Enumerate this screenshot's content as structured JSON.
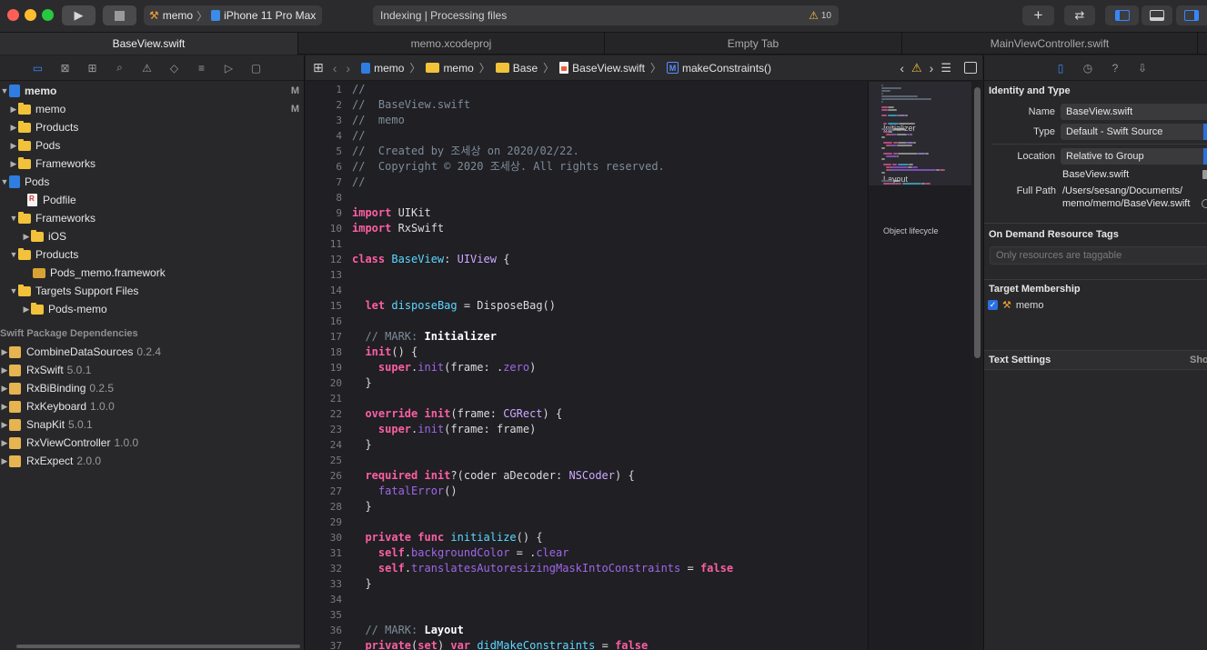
{
  "toolbar": {
    "scheme_project": "memo",
    "scheme_device": "iPhone 11 Pro Max",
    "activity_text": "Indexing | Processing files",
    "warning_count": "10"
  },
  "tabs": [
    "BaseView.swift",
    "memo.xcodeproj",
    "Empty Tab",
    "MainViewController.swift"
  ],
  "navigator": {
    "tree": [
      {
        "label": "memo",
        "flag": "M"
      },
      {
        "label": "memo",
        "flag": "M"
      },
      {
        "label": "Products"
      },
      {
        "label": "Pods"
      },
      {
        "label": "Frameworks"
      },
      {
        "label": "Pods"
      },
      {
        "label": "Podfile"
      },
      {
        "label": "Frameworks"
      },
      {
        "label": "iOS"
      },
      {
        "label": "Products"
      },
      {
        "label": "Pods_memo.framework"
      },
      {
        "label": "Targets Support Files"
      },
      {
        "label": "Pods-memo"
      }
    ],
    "packages_header": "Swift Package Dependencies",
    "packages": [
      {
        "name": "CombineDataSources",
        "version": "0.2.4"
      },
      {
        "name": "RxSwift",
        "version": "5.0.1"
      },
      {
        "name": "RxBiBinding",
        "version": "0.2.5"
      },
      {
        "name": "RxKeyboard",
        "version": "1.0.0"
      },
      {
        "name": "SnapKit",
        "version": "5.0.1"
      },
      {
        "name": "RxViewController",
        "version": "1.0.0"
      },
      {
        "name": "RxExpect",
        "version": "2.0.0"
      }
    ]
  },
  "jumpbar": {
    "path": [
      "memo",
      "memo",
      "Base",
      "BaseView.swift"
    ],
    "symbol": "makeConstraints()"
  },
  "editor": {
    "line_numbers": [
      "1",
      "2",
      "3",
      "4",
      "5",
      "6",
      "7",
      "8",
      "9",
      "10",
      "11",
      "12",
      "13",
      "14",
      "15",
      "16",
      "17",
      "18",
      "19",
      "20",
      "21",
      "22",
      "23",
      "24",
      "25",
      "26",
      "27",
      "28",
      "29",
      "30",
      "31",
      "32",
      "33",
      "34",
      "35",
      "36",
      "37"
    ],
    "lines": [
      [
        {
          "c": "cmt",
          "t": "//"
        }
      ],
      [
        {
          "c": "cmt",
          "t": "//  BaseView.swift"
        }
      ],
      [
        {
          "c": "cmt",
          "t": "//  memo"
        }
      ],
      [
        {
          "c": "cmt",
          "t": "//"
        }
      ],
      [
        {
          "c": "cmt",
          "t": "//  Created by 조세상 on 2020/02/22."
        }
      ],
      [
        {
          "c": "cmt",
          "t": "//  Copyright © 2020 조세상. All rights reserved."
        }
      ],
      [
        {
          "c": "cmt",
          "t": "//"
        }
      ],
      [],
      [
        {
          "c": "kw",
          "t": "import"
        },
        {
          "c": "",
          "t": " UIKit"
        }
      ],
      [
        {
          "c": "kw",
          "t": "import"
        },
        {
          "c": "",
          "t": " RxSwift"
        }
      ],
      [],
      [
        {
          "c": "kw",
          "t": "class"
        },
        {
          "c": "",
          "t": " "
        },
        {
          "c": "ty",
          "t": "BaseView"
        },
        {
          "c": "",
          "t": ": "
        },
        {
          "c": "ty2",
          "t": "UIView"
        },
        {
          "c": "",
          "t": " {"
        }
      ],
      [],
      [],
      [
        {
          "c": "",
          "t": "  "
        },
        {
          "c": "kw",
          "t": "let"
        },
        {
          "c": "",
          "t": " "
        },
        {
          "c": "ty",
          "t": "disposeBag"
        },
        {
          "c": "",
          "t": " = DisposeBag()"
        }
      ],
      [],
      [
        {
          "c": "cmt",
          "t": "  // MARK: "
        },
        {
          "c": "mark",
          "t": "Initializer"
        }
      ],
      [
        {
          "c": "",
          "t": "  "
        },
        {
          "c": "kw",
          "t": "init"
        },
        {
          "c": "",
          "t": "() {"
        }
      ],
      [
        {
          "c": "",
          "t": "    "
        },
        {
          "c": "kw",
          "t": "super"
        },
        {
          "c": "",
          "t": "."
        },
        {
          "c": "prop",
          "t": "init"
        },
        {
          "c": "",
          "t": "(frame: ."
        },
        {
          "c": "prop",
          "t": "zero"
        },
        {
          "c": "",
          "t": ")"
        }
      ],
      [
        {
          "c": "",
          "t": "  }"
        }
      ],
      [],
      [
        {
          "c": "",
          "t": "  "
        },
        {
          "c": "kw",
          "t": "override"
        },
        {
          "c": "",
          "t": " "
        },
        {
          "c": "kw",
          "t": "init"
        },
        {
          "c": "",
          "t": "(frame: "
        },
        {
          "c": "ty2",
          "t": "CGRect"
        },
        {
          "c": "",
          "t": ") {"
        }
      ],
      [
        {
          "c": "",
          "t": "    "
        },
        {
          "c": "kw",
          "t": "super"
        },
        {
          "c": "",
          "t": "."
        },
        {
          "c": "prop",
          "t": "init"
        },
        {
          "c": "",
          "t": "(frame: frame)"
        }
      ],
      [
        {
          "c": "",
          "t": "  }"
        }
      ],
      [],
      [
        {
          "c": "",
          "t": "  "
        },
        {
          "c": "kw",
          "t": "required"
        },
        {
          "c": "",
          "t": " "
        },
        {
          "c": "kw",
          "t": "init"
        },
        {
          "c": "",
          "t": "?(coder aDecoder: "
        },
        {
          "c": "ty2",
          "t": "NSCoder"
        },
        {
          "c": "",
          "t": ") {"
        }
      ],
      [
        {
          "c": "",
          "t": "    "
        },
        {
          "c": "prop",
          "t": "fatalError"
        },
        {
          "c": "",
          "t": "()"
        }
      ],
      [
        {
          "c": "",
          "t": "  }"
        }
      ],
      [],
      [
        {
          "c": "",
          "t": "  "
        },
        {
          "c": "kw",
          "t": "private"
        },
        {
          "c": "",
          "t": " "
        },
        {
          "c": "kw",
          "t": "func"
        },
        {
          "c": "",
          "t": " "
        },
        {
          "c": "ty",
          "t": "initialize"
        },
        {
          "c": "",
          "t": "() {"
        }
      ],
      [
        {
          "c": "",
          "t": "    "
        },
        {
          "c": "kw",
          "t": "self"
        },
        {
          "c": "",
          "t": "."
        },
        {
          "c": "prop",
          "t": "backgroundColor"
        },
        {
          "c": "",
          "t": " = ."
        },
        {
          "c": "prop",
          "t": "clear"
        }
      ],
      [
        {
          "c": "",
          "t": "    "
        },
        {
          "c": "kw",
          "t": "self"
        },
        {
          "c": "",
          "t": "."
        },
        {
          "c": "prop",
          "t": "translatesAutoresizingMaskIntoConstraints"
        },
        {
          "c": "",
          "t": " = "
        },
        {
          "c": "kw",
          "t": "false"
        }
      ],
      [
        {
          "c": "",
          "t": "  }"
        }
      ],
      [],
      [],
      [
        {
          "c": "cmt",
          "t": "  // MARK: "
        },
        {
          "c": "mark",
          "t": "Layout"
        }
      ],
      [
        {
          "c": "",
          "t": "  "
        },
        {
          "c": "kw",
          "t": "private"
        },
        {
          "c": "",
          "t": "("
        },
        {
          "c": "kw",
          "t": "set"
        },
        {
          "c": "",
          "t": ") "
        },
        {
          "c": "kw",
          "t": "var"
        },
        {
          "c": "",
          "t": " "
        },
        {
          "c": "ty",
          "t": "didMakeConstraints"
        },
        {
          "c": "",
          "t": " = "
        },
        {
          "c": "kw",
          "t": "false"
        }
      ]
    ]
  },
  "minimap": {
    "labels": [
      "Initializer",
      "Layout",
      "Object lifecycle"
    ]
  },
  "inspector": {
    "identity_header": "Identity and Type",
    "name_label": "Name",
    "name_value": "BaseView.swift",
    "type_label": "Type",
    "type_value": "Default - Swift Source",
    "location_label": "Location",
    "location_value": "Relative to Group",
    "location_file": "BaseView.swift",
    "fullpath_label": "Full Path",
    "fullpath_value_1": "/Users/sesang/Documents/",
    "fullpath_value_2": "memo/memo/BaseView.swift",
    "ondemand_header": "On Demand Resource Tags",
    "ondemand_placeholder": "Only resources are taggable",
    "target_header": "Target Membership",
    "target_name": "memo",
    "text_settings_header": "Text Settings",
    "text_settings_show": "Sho"
  },
  "colors": {
    "accent": "#3a86f7",
    "keyword": "#fc5fa3",
    "type": "#5dd8ff",
    "comment": "#7f8c98",
    "folder": "#f1c23a"
  }
}
